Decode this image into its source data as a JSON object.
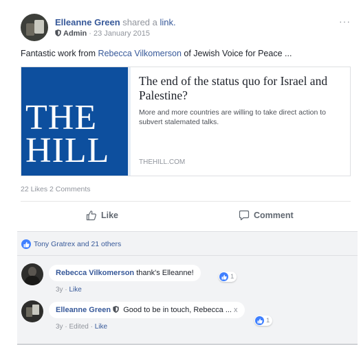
{
  "post": {
    "author": "Elleanne Green",
    "action_text": "shared a",
    "link_word": "link.",
    "role": "Admin",
    "date": "· 23 January 2015",
    "more_menu": "···",
    "text_prefix": "Fantastic work from",
    "text_mention": "Rebecca Vilkomerson",
    "text_suffix": "of Jewish Voice for Peace ..."
  },
  "link_card": {
    "logo_line1": "THE",
    "logo_line2": "HILL",
    "title": "The end of the status quo for Israel and Palestine?",
    "description": "More and more countries are willing to take direct action to subvert stalemated talks.",
    "domain": "THEHILL.COM"
  },
  "counts": {
    "likes": "22 Likes",
    "comments": "2 Comments"
  },
  "actions": {
    "like_label": "Like",
    "comment_label": "Comment"
  },
  "reactions": {
    "summary": "Tony Gratrex and 21 others"
  },
  "comments": [
    {
      "author": "Rebecca Vilkomerson",
      "text": "thank's Elleanne!",
      "time": "3y",
      "like_label": "Like",
      "reaction_count": "1"
    },
    {
      "author": "Elleanne Green",
      "text": "Good to be in touch, Rebecca ...",
      "close": "x",
      "time": "3y",
      "edited": "Edited",
      "like_label": "Like",
      "reaction_count": "1"
    }
  ],
  "colors": {
    "link_blue": "#365899",
    "hill_blue": "#0d4f9e",
    "like_badge": "#4080ff",
    "muted_text": "#90949c",
    "comment_area_bg": "#f2f3f5"
  },
  "icons": [
    "shield-icon",
    "more-icon",
    "thumbs-up-icon",
    "comment-icon",
    "like-badge-icon"
  ]
}
